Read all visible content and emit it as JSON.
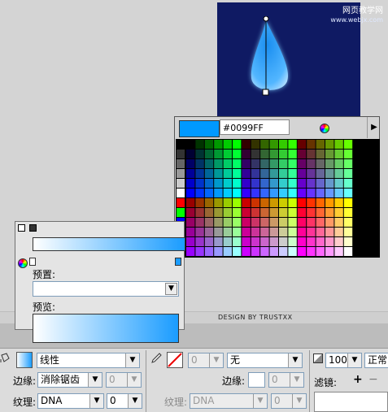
{
  "watermark": {
    "line1": "网页教学网",
    "line2": "www.webjx.com"
  },
  "credit": "DESIGN BY TRUSTXX",
  "swatches": {
    "hex_value": "#0099FF",
    "current_color": "#0099ff",
    "fixed_colors": [
      "#000000",
      "#333333",
      "#666666",
      "#999999",
      "#cccccc",
      "#ffffff",
      "#ff0000",
      "#00ff00",
      "#0000ff",
      "#ffff00",
      "#00ffff",
      "#ff00ff"
    ]
  },
  "fill_panel": {
    "preset_label": "预置:",
    "preview_label": "预览:",
    "gradient_start": "#ffffff",
    "gradient_end": "#1a9cff"
  },
  "props": {
    "fill_type": "线性",
    "edge_label": "边缘:",
    "edge_value": "消除锯齿",
    "edge_amount": "0",
    "texture_label": "纹理:",
    "texture_value": "DNA",
    "texture_amount": "0",
    "stroke_size": "0",
    "stroke_type": "无",
    "stroke_edge_label": "边缘:",
    "stroke_edge_amount": "0",
    "stroke_texture_label": "纹理:",
    "stroke_texture_value": "DNA",
    "stroke_texture_amount": "0",
    "opacity": "100",
    "blend_mode": "正常",
    "filters_label": "滤镜:",
    "add_filter": "+",
    "remove_filter": "−"
  }
}
